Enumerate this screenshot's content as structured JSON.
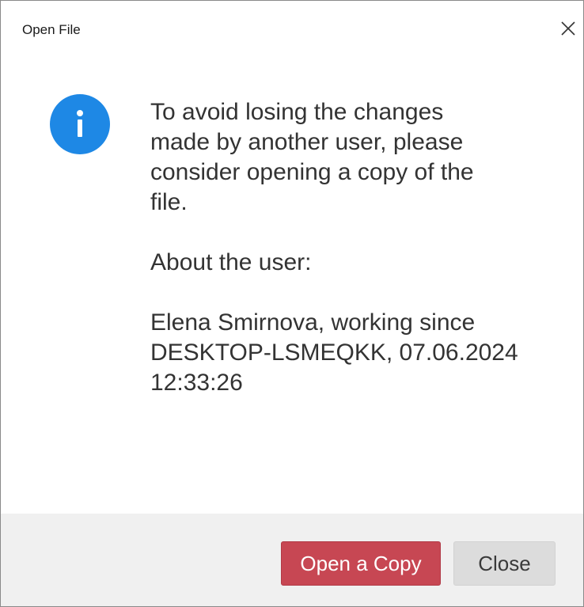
{
  "dialog": {
    "title": "Open File"
  },
  "message": {
    "paragraph1": "To avoid losing the changes\nmade by another user, please\nconsider opening a copy of the\nfile.",
    "paragraph2": "About the user:",
    "paragraph3": "Elena Smirnova, working since\nDESKTOP-LSMEQKK, 07.06.2024\n12:33:26"
  },
  "icons": {
    "info": "info-icon",
    "close": "close-icon"
  },
  "buttons": {
    "open_copy_label": "Open a Copy",
    "close_label": "Close"
  },
  "colors": {
    "info_blue": "#1e88e5",
    "primary_button": "#c74753",
    "secondary_button": "#dcdcdc",
    "footer_background": "#f0f0f0"
  }
}
